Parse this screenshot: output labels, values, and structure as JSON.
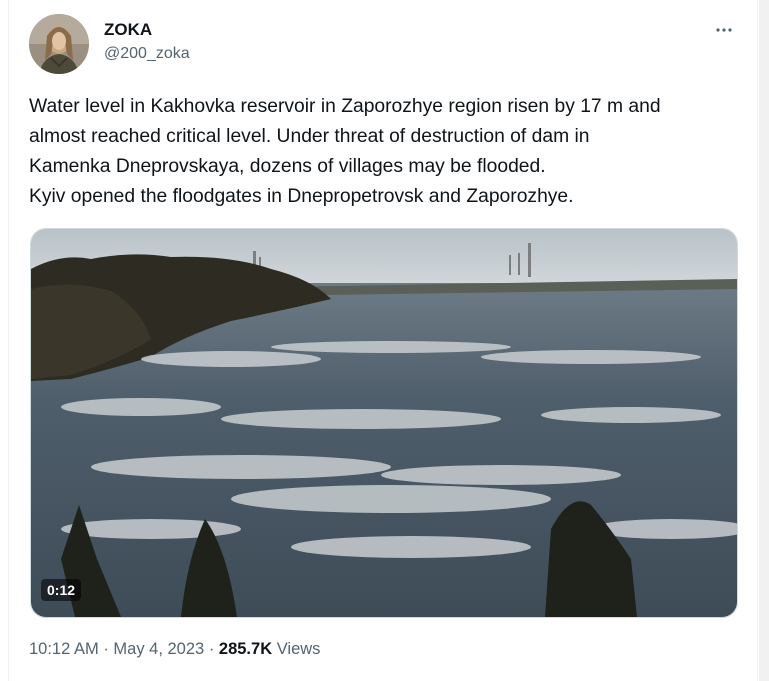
{
  "author": {
    "name": "ZOKA",
    "handle": "@200_zoka"
  },
  "tweet": {
    "lines": [
      "Water level in Kakhovka reservoir in Zaporozhye region risen by 17 m and",
      "almost reached critical level. Under threat of destruction of dam in",
      "Kamenka Dneprovskaya, dozens of villages may be flooded.",
      "Kyiv opened the floodgates in Dnepropetrovsk and Zaporozhye."
    ]
  },
  "media": {
    "type": "video",
    "duration": "0:12"
  },
  "meta": {
    "time": "10:12 AM",
    "separator": "·",
    "date": "May 4, 2023",
    "views_count": "285.7K",
    "views_label": "Views"
  },
  "icons": {
    "more": "more-dots-icon"
  },
  "colors": {
    "text_primary": "#0f1419",
    "text_secondary": "#536471",
    "border": "#cfd9de"
  }
}
